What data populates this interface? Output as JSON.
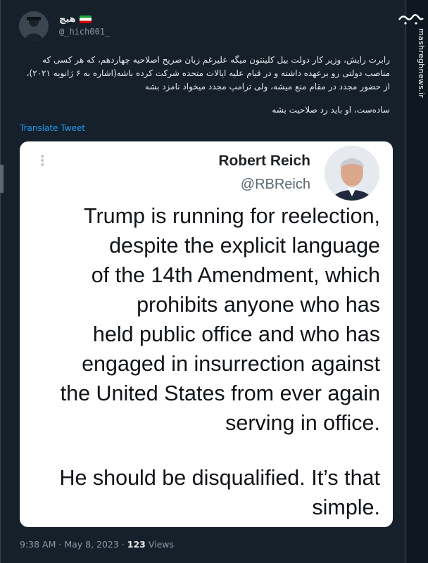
{
  "author": {
    "display_name": "هیچ",
    "handle": "@_hich001_"
  },
  "tweet": {
    "paragraphs": [
      "رابرت رایش، وزیر کار دولت بیل کلینتون میگه علیرغم زبان صریح اصلاحیه چهاردهم، که هر کسی که مناصب دولتی رو برعهده داشته و در قیام علیه ایالات متحده شرکت کرده باشه(اشاره به ۶ ژانویه ۲۰۲۱)، از حضور مجدد در مقام منع میشه، ولی ترامپ مجدد میخواد نامزد بشه",
      "سادەست، او باید رد صلاحیت بشه"
    ],
    "translate_label": "Translate Tweet"
  },
  "quoted_image": {
    "name": "Robert Reich",
    "handle": "@RBReich",
    "lines": [
      "Trump is running for reelection,",
      "despite the explicit language",
      "of the 14th Amendment, which",
      "prohibits anyone who has",
      "held public office and who has",
      "engaged in insurrection against",
      "the United States from ever again",
      "serving in office."
    ],
    "closing_lines": [
      "He should be disqualified. It’s that",
      "simple."
    ]
  },
  "meta": {
    "time": "9:38 AM",
    "separator": " · ",
    "date": "May 8, 2023",
    "views_count": "123",
    "views_label": "Views"
  },
  "watermark": {
    "logo": "مشرق",
    "url": "mashreghnews.ir"
  },
  "colors": {
    "background": "#15202b",
    "link": "#1d9bf0",
    "muted": "#8b98a5"
  }
}
